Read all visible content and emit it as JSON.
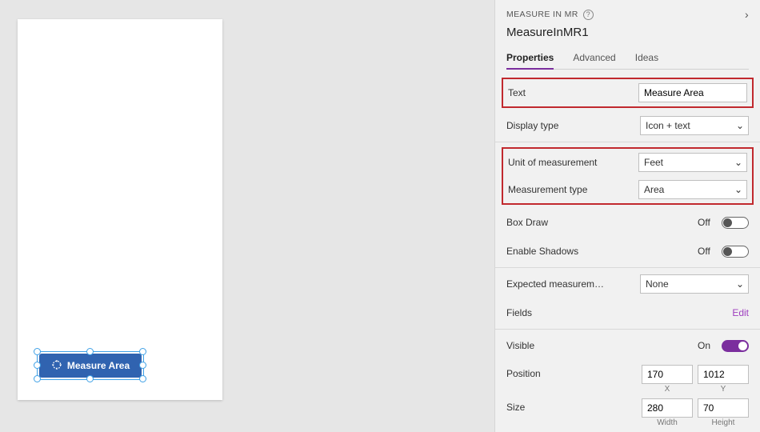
{
  "canvas": {
    "button_label": "Measure Area"
  },
  "panel": {
    "category": "MEASURE IN MR",
    "control_name": "MeasureInMR1",
    "tabs": {
      "properties": "Properties",
      "advanced": "Advanced",
      "ideas": "Ideas"
    },
    "props": {
      "text": {
        "label": "Text",
        "value": "Measure Area"
      },
      "display_type": {
        "label": "Display type",
        "value": "Icon + text"
      },
      "unit": {
        "label": "Unit of measurement",
        "value": "Feet"
      },
      "mtype": {
        "label": "Measurement type",
        "value": "Area"
      },
      "box_draw": {
        "label": "Box Draw",
        "state": "Off"
      },
      "shadows": {
        "label": "Enable Shadows",
        "state": "Off"
      },
      "expected": {
        "label": "Expected measurem…",
        "value": "None"
      },
      "fields": {
        "label": "Fields",
        "link": "Edit"
      },
      "visible": {
        "label": "Visible",
        "state": "On"
      },
      "position": {
        "label": "Position",
        "x": "170",
        "y": "1012",
        "xcap": "X",
        "ycap": "Y"
      },
      "size": {
        "label": "Size",
        "w": "280",
        "h": "70",
        "wcap": "Width",
        "hcap": "Height"
      }
    }
  }
}
